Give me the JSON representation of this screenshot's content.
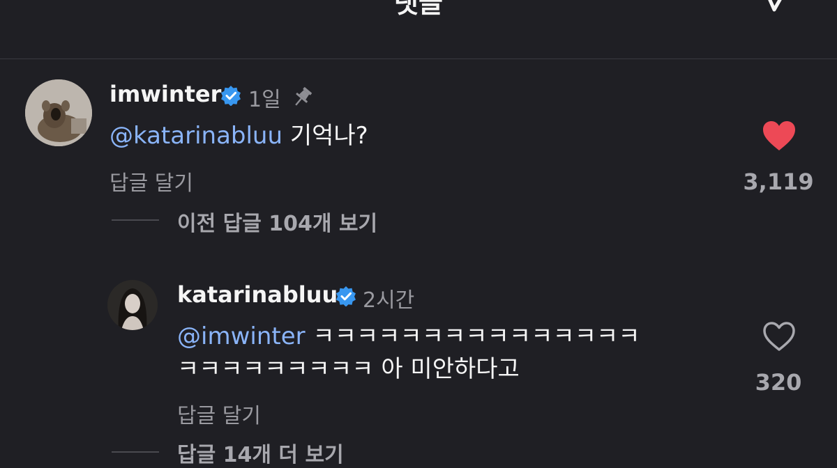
{
  "header": {
    "title": "댓글",
    "icon": "filter-icon"
  },
  "comments": [
    {
      "username": "imwinter",
      "verified": true,
      "time": "1일",
      "pinned": true,
      "mention": "@katarinabluu",
      "text": " 기억나?",
      "reply_label": "답글 달기",
      "likes": "3,119",
      "liked": true,
      "view_replies_label": "이전 답글 104개 보기"
    },
    {
      "username": "katarinabluu",
      "verified": true,
      "time": "2시간",
      "pinned": false,
      "mention": "@imwinter",
      "text": " ㅋㅋㅋㅋㅋㅋㅋㅋㅋㅋㅋㅋㅋㅋㅋㅋㅋㅋㅋㅋㅋㅋㅋ ㅋ",
      "text_line1": " ㅋㅋㅋㅋㅋㅋㅋㅋㅋㅋㅋㅋㅋㅋㅋ",
      "text_line2": "ㅋㅋㅋㅋㅋㅋㅋㅋㅋ 아 미안하다고",
      "reply_label": "답글 달기",
      "likes": "320",
      "liked": false,
      "view_replies_label": "답글 14개 더 보기"
    }
  ],
  "colors": {
    "background": "#1f1f24",
    "mention": "#8ab4f8",
    "verified": "#3897f0",
    "liked": "#ed4956",
    "muted": "#9a9aa0"
  }
}
